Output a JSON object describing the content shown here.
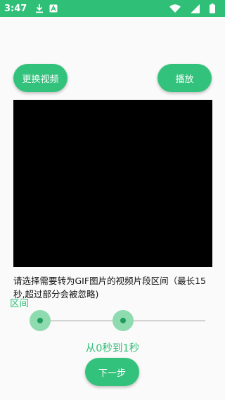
{
  "status_bar": {
    "time": "3:47",
    "icons_left": [
      "download-icon",
      "a-icon"
    ],
    "icons_right": [
      "wifi-icon",
      "signal-icon",
      "battery-icon"
    ],
    "color": "#2fbf77"
  },
  "buttons": {
    "change_video": "更换视频",
    "play": "播放",
    "next_step": "下一步"
  },
  "hint_text": "请选择需要转为GIF图片的视频片段区间（最长15秒,超过部分会被忽略)",
  "range": {
    "label": "区间",
    "value_text": "从0秒到1秒",
    "start_fraction": 0.0,
    "end_fraction": 0.5
  },
  "colors": {
    "accent": "#33c27c",
    "accent_text": "#2fbf77",
    "thumb": "#8fdbb0",
    "video_bg": "#000000"
  }
}
